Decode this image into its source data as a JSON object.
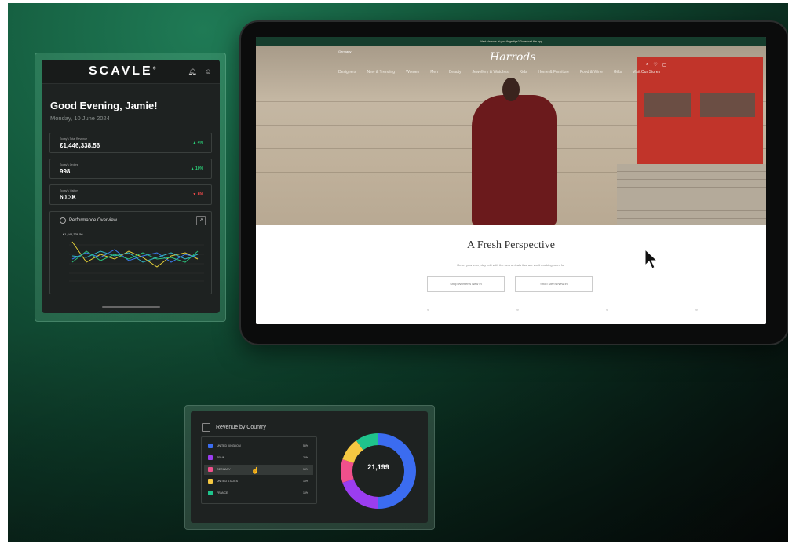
{
  "dashboard": {
    "logo": "SCAVLE",
    "logo_mark": "®",
    "greeting": "Good Evening, Jamie!",
    "date": "Monday, 10 June 2024",
    "kpis": [
      {
        "label": "Today's Total Revenue",
        "value": "€1,446,338.56",
        "change": "▲ 4%",
        "trend": "up"
      },
      {
        "label": "Today's Orders",
        "value": "998",
        "change": "▲ 10%",
        "trend": "up"
      },
      {
        "label": "Today's Visitors",
        "value": "60.3K",
        "change": "▼ 6%",
        "trend": "down"
      }
    ],
    "performance": {
      "title": "Performance Overview",
      "value": "€1,446,338.56"
    }
  },
  "storefront": {
    "banner_text": "Want Harrods at your fingertips? Download the app",
    "logo": "Harrods",
    "country": "Germany",
    "nav": [
      "Designers",
      "New & Trending",
      "Women",
      "Men",
      "Beauty",
      "Jewellery & Watches",
      "Kids",
      "Home & Furniture",
      "Food & Wine",
      "Gifts",
      "Visit Our Stores"
    ],
    "headline": "A Fresh Perspective",
    "subtext": "Reset your everyday edit with the new arrivals that are worth making room for",
    "buttons": [
      "Shop Women's New In",
      "Shop Men's New In"
    ]
  },
  "revenue": {
    "title": "Revenue by Country",
    "total": "21,199",
    "rows": [
      {
        "label": "UNITED KINGDOM",
        "pct": "50%",
        "color": "#3b6cf0"
      },
      {
        "label": "SPAIN",
        "pct": "20%",
        "color": "#9b3df0"
      },
      {
        "label": "GERMANY",
        "pct": "10%",
        "color": "#f0508c"
      },
      {
        "label": "UNITED STATES",
        "pct": "10%",
        "color": "#f5c842"
      },
      {
        "label": "FRANCE",
        "pct": "10%",
        "color": "#1fc48c"
      }
    ],
    "selected_index": 2,
    "shares": [
      0.5,
      0.2,
      0.1,
      0.1,
      0.1
    ]
  }
}
